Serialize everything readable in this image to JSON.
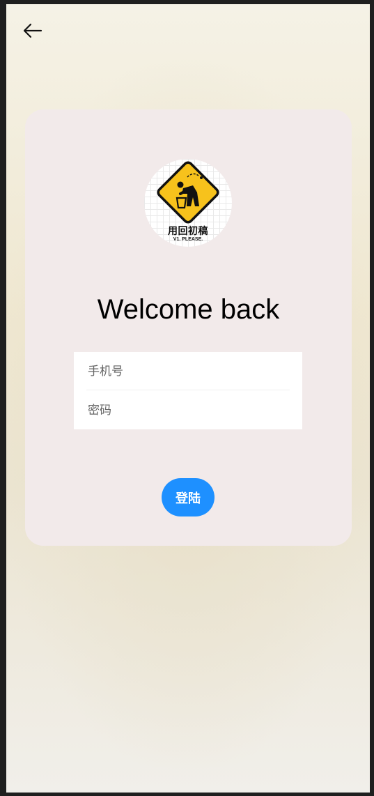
{
  "header": {
    "back_icon": "arrow-left-icon"
  },
  "logo": {
    "title": "用回初稿",
    "subtitle": "V1. PLEASE.",
    "icon": "trash-sign-icon",
    "accent_color": "#f7c21c"
  },
  "welcome": {
    "heading": "Welcome back"
  },
  "form": {
    "phone_placeholder": "手机号",
    "password_placeholder": "密码"
  },
  "actions": {
    "login_label": "登陆",
    "login_color": "#1e90ff"
  }
}
